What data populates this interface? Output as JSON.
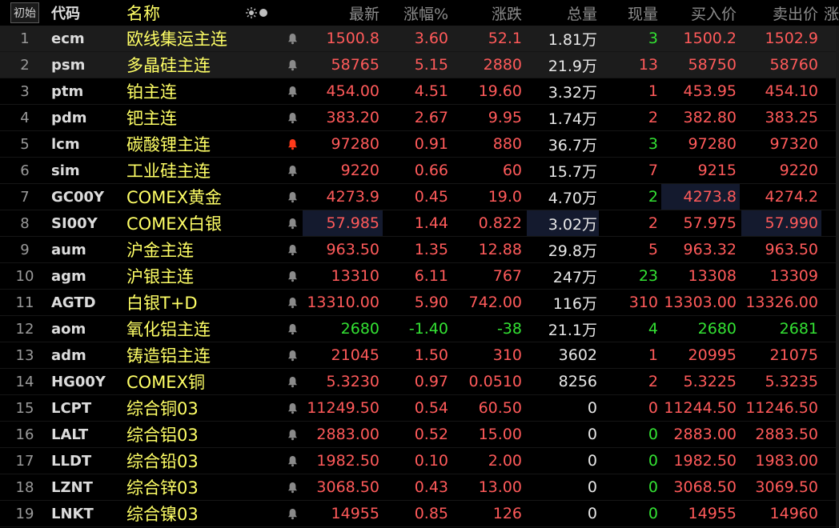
{
  "header": {
    "init": "初始",
    "code": "代码",
    "name": "名称",
    "last": "最新",
    "pct": "涨幅%",
    "chg": "涨跌",
    "vol": "总量",
    "cur": "现量",
    "bid": "买入价",
    "ask": "卖出价",
    "extra": "涨"
  },
  "colors": {
    "up": "#ff5a5a",
    "down": "#33e133",
    "name": "#ffff66",
    "alert": "#ff3a1a"
  },
  "rows": [
    {
      "no": "1",
      "code": "ecm",
      "name": "欧线集运主连",
      "last": "1500.8",
      "pct": "3.60",
      "chg": "52.1",
      "vol": "1.81万",
      "cur": "3",
      "bid": "1500.2",
      "ask": "1502.9",
      "dir": "up",
      "cur_dir": "down"
    },
    {
      "no": "2",
      "code": "psm",
      "name": "多晶硅主连",
      "last": "58765",
      "pct": "5.15",
      "chg": "2880",
      "vol": "21.9万",
      "cur": "13",
      "bid": "58750",
      "ask": "58760",
      "dir": "up",
      "cur_dir": "up"
    },
    {
      "no": "3",
      "code": "ptm",
      "name": "铂主连",
      "last": "454.00",
      "pct": "4.51",
      "chg": "19.60",
      "vol": "3.32万",
      "cur": "1",
      "bid": "453.95",
      "ask": "454.10",
      "dir": "up",
      "cur_dir": "up"
    },
    {
      "no": "4",
      "code": "pdm",
      "name": "钯主连",
      "last": "383.20",
      "pct": "2.67",
      "chg": "9.95",
      "vol": "1.74万",
      "cur": "2",
      "bid": "382.80",
      "ask": "383.25",
      "dir": "up",
      "cur_dir": "up"
    },
    {
      "no": "5",
      "code": "lcm",
      "name": "碳酸锂主连",
      "last": "97280",
      "pct": "0.91",
      "chg": "880",
      "vol": "36.7万",
      "cur": "3",
      "bid": "97280",
      "ask": "97320",
      "dir": "up",
      "cur_dir": "down"
    },
    {
      "no": "6",
      "code": "sim",
      "name": "工业硅主连",
      "last": "9220",
      "pct": "0.66",
      "chg": "60",
      "vol": "15.7万",
      "cur": "7",
      "bid": "9215",
      "ask": "9220",
      "dir": "up",
      "cur_dir": "up"
    },
    {
      "no": "7",
      "code": "GC00Y",
      "name": "COMEX黄金",
      "last": "4273.9",
      "pct": "0.45",
      "chg": "19.0",
      "vol": "4.70万",
      "cur": "2",
      "bid": "4273.8",
      "ask": "4274.2",
      "dir": "up",
      "cur_dir": "down"
    },
    {
      "no": "8",
      "code": "SI00Y",
      "name": "COMEX白银",
      "last": "57.985",
      "pct": "1.44",
      "chg": "0.822",
      "vol": "3.02万",
      "cur": "2",
      "bid": "57.975",
      "ask": "57.990",
      "dir": "up",
      "cur_dir": "up"
    },
    {
      "no": "9",
      "code": "aum",
      "name": "沪金主连",
      "last": "963.50",
      "pct": "1.35",
      "chg": "12.88",
      "vol": "29.8万",
      "cur": "5",
      "bid": "963.32",
      "ask": "963.50",
      "dir": "up",
      "cur_dir": "up"
    },
    {
      "no": "10",
      "code": "agm",
      "name": "沪银主连",
      "last": "13310",
      "pct": "6.11",
      "chg": "767",
      "vol": "247万",
      "cur": "23",
      "bid": "13308",
      "ask": "13309",
      "dir": "up",
      "cur_dir": "down"
    },
    {
      "no": "11",
      "code": "AGTD",
      "name": "白银T+D",
      "last": "13310.00",
      "pct": "5.90",
      "chg": "742.00",
      "vol": "116万",
      "cur": "310",
      "bid": "13303.00",
      "ask": "13326.00",
      "dir": "up",
      "cur_dir": "up"
    },
    {
      "no": "12",
      "code": "aom",
      "name": "氧化铝主连",
      "last": "2680",
      "pct": "-1.40",
      "chg": "-38",
      "vol": "21.1万",
      "cur": "4",
      "bid": "2680",
      "ask": "2681",
      "dir": "down",
      "cur_dir": "down"
    },
    {
      "no": "13",
      "code": "adm",
      "name": "铸造铝主连",
      "last": "21045",
      "pct": "1.50",
      "chg": "310",
      "vol": "3602",
      "cur": "1",
      "bid": "20995",
      "ask": "21075",
      "dir": "up",
      "cur_dir": "up"
    },
    {
      "no": "14",
      "code": "HG00Y",
      "name": "COMEX铜",
      "last": "5.3230",
      "pct": "0.97",
      "chg": "0.0510",
      "vol": "8256",
      "cur": "2",
      "bid": "5.3225",
      "ask": "5.3235",
      "dir": "up",
      "cur_dir": "up"
    },
    {
      "no": "15",
      "code": "LCPT",
      "name": "综合铜03",
      "last": "11249.50",
      "pct": "0.54",
      "chg": "60.50",
      "vol": "0",
      "cur": "0",
      "bid": "11244.50",
      "ask": "11246.50",
      "dir": "up",
      "cur_dir": "up"
    },
    {
      "no": "16",
      "code": "LALT",
      "name": "综合铝03",
      "last": "2883.00",
      "pct": "0.52",
      "chg": "15.00",
      "vol": "0",
      "cur": "0",
      "bid": "2883.00",
      "ask": "2883.50",
      "dir": "up",
      "cur_dir": "down"
    },
    {
      "no": "17",
      "code": "LLDT",
      "name": "综合铅03",
      "last": "1982.50",
      "pct": "0.10",
      "chg": "2.00",
      "vol": "0",
      "cur": "0",
      "bid": "1982.50",
      "ask": "1983.00",
      "dir": "up",
      "cur_dir": "down"
    },
    {
      "no": "18",
      "code": "LZNT",
      "name": "综合锌03",
      "last": "3068.50",
      "pct": "0.43",
      "chg": "13.00",
      "vol": "0",
      "cur": "0",
      "bid": "3068.50",
      "ask": "3069.50",
      "dir": "up",
      "cur_dir": "down"
    },
    {
      "no": "19",
      "code": "LNKT",
      "name": "综合镍03",
      "last": "14955",
      "pct": "0.85",
      "chg": "126",
      "vol": "0",
      "cur": "0",
      "bid": "14955",
      "ask": "14960",
      "dir": "up",
      "cur_dir": "down"
    }
  ]
}
